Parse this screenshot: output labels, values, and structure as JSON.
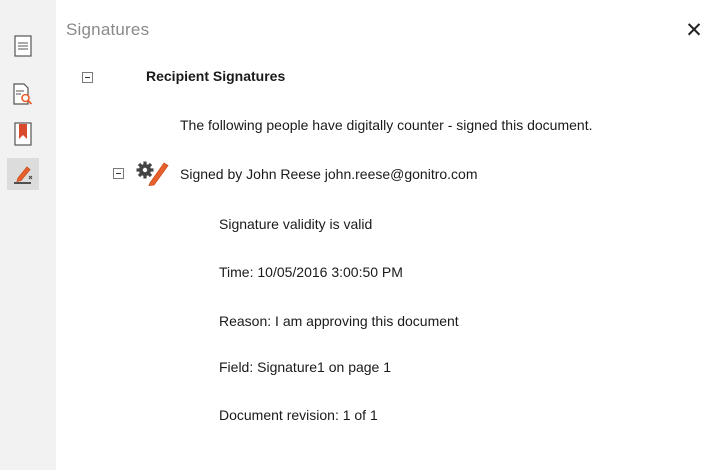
{
  "toolbar": {
    "items": [
      {
        "name": "page-thumbnails",
        "icon": "page-icon"
      },
      {
        "name": "search",
        "icon": "page-search-icon"
      },
      {
        "name": "bookmarks",
        "icon": "bookmark-icon"
      },
      {
        "name": "signatures",
        "icon": "signature-pen-icon",
        "active": true
      }
    ]
  },
  "panel": {
    "title": "Signatures",
    "close_glyph": "✕"
  },
  "tree": {
    "group_label": "Recipient Signatures",
    "group_description": "The following people have digitally counter - signed this document.",
    "signer": {
      "label": "Signed by John Reese john.reese@gonitro.com",
      "icon": "signature-settings-icon",
      "details": [
        "Signature validity is valid",
        "Time: 10/05/2016 3:00:50 PM",
        "Reason: I am approving this document",
        "Field: Signature1 on page 1",
        "Document revision: 1 of 1"
      ]
    }
  },
  "colors": {
    "toolbar_bg": "#f2f2f2",
    "active_bg": "#dcdcdc",
    "accent": "#e8602c",
    "bookmark": "#d9492b"
  }
}
